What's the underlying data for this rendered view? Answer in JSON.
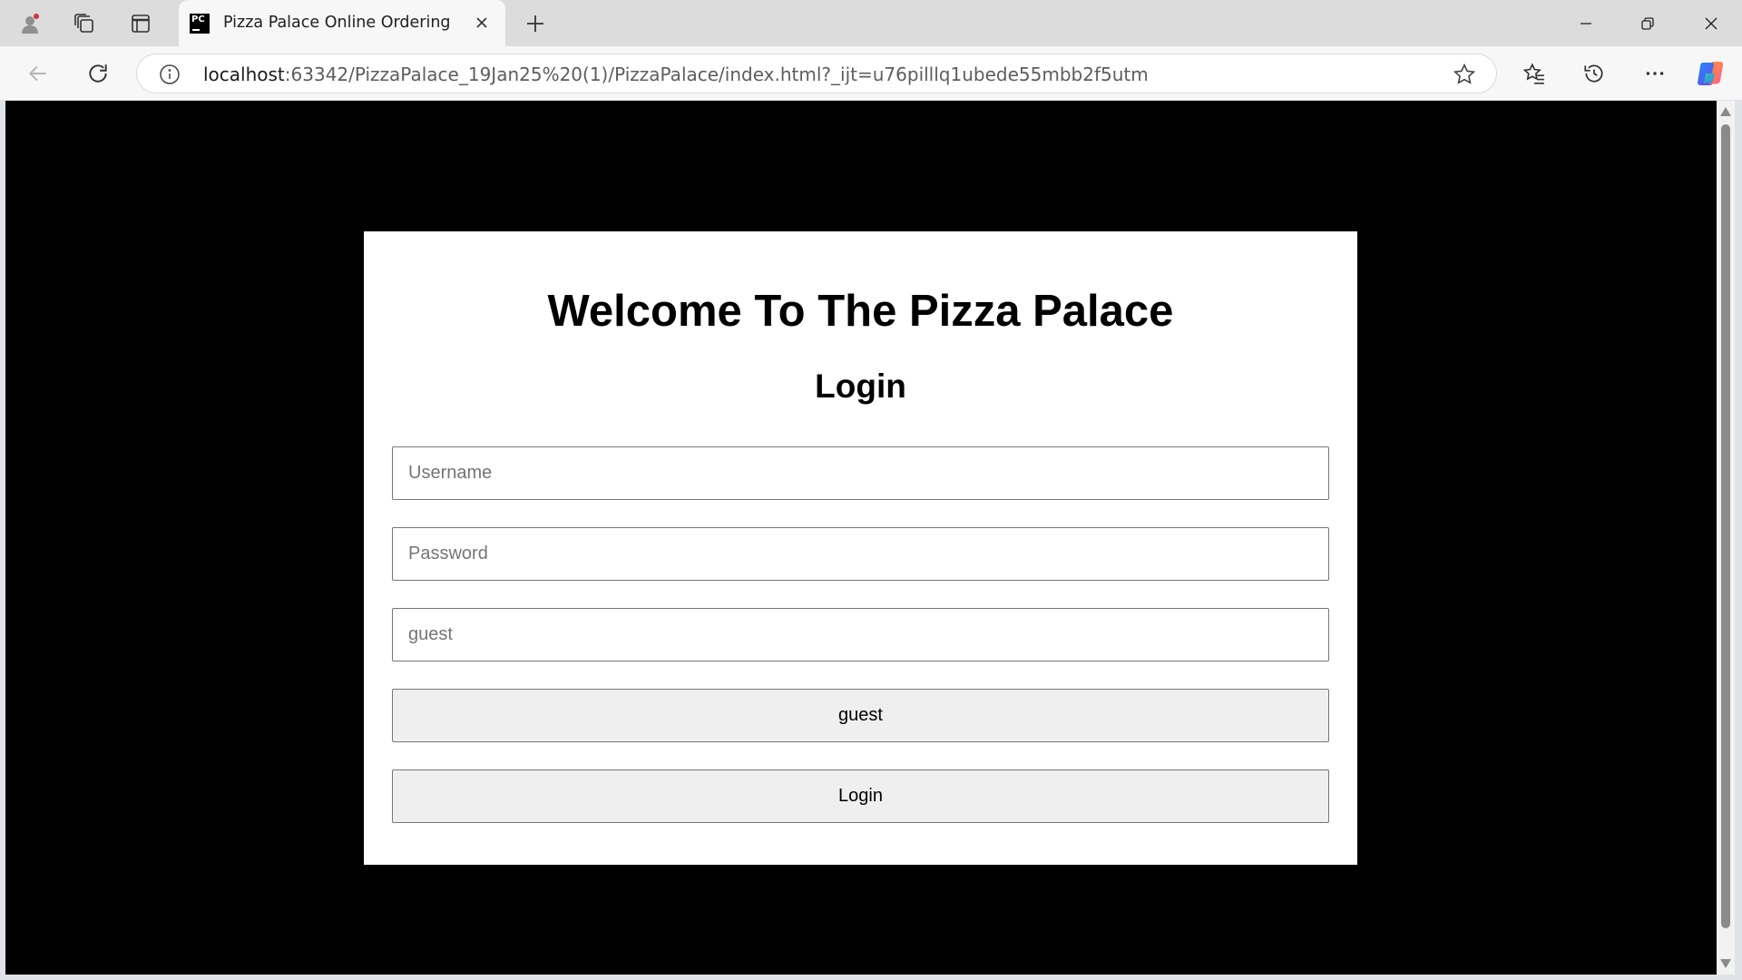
{
  "browser": {
    "tab_title": "Pizza Palace Online Ordering",
    "tab_favicon_text": "PC",
    "url_host": "localhost",
    "url_rest": ":63342/PizzaPalace_19Jan25%20(1)/PizzaPalace/index.html?_ijt=u76pilllq1ubede55mbb2f5utm",
    "icons": {
      "profile": "profile-icon",
      "workspaces": "workspaces-icon",
      "tab_actions": "tab-actions-icon",
      "new_tab": "plus-icon",
      "back": "back-arrow-icon",
      "refresh": "refresh-icon",
      "info": "info-icon",
      "favorite": "star-icon",
      "favorites": "favorites-icon",
      "history": "history-icon",
      "more": "more-icon",
      "copilot": "copilot-icon"
    }
  },
  "login": {
    "heading": "Welcome To The Pizza Palace",
    "subheading": "Login",
    "username_placeholder": "Username",
    "password_placeholder": "Password",
    "guest_field_placeholder": "guest",
    "guest_button_label": "guest",
    "login_button_label": "Login"
  },
  "colors": {
    "page_background": "#000000",
    "card_background": "#ffffff",
    "button_background": "#efefef"
  }
}
